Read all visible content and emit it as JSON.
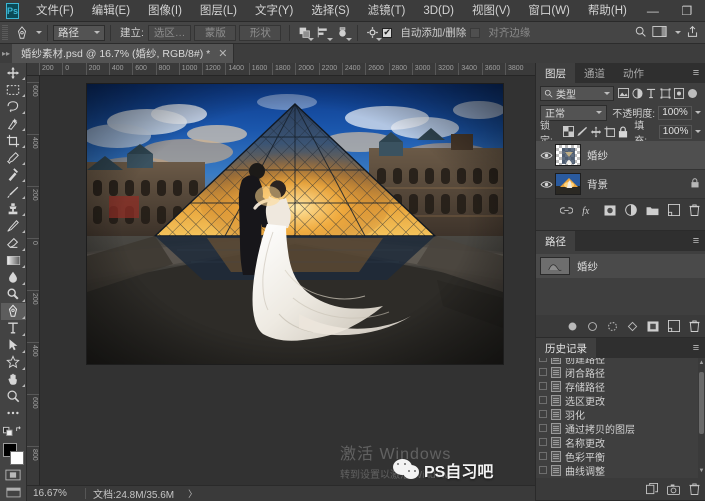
{
  "app": {
    "name": "Adobe Photoshop",
    "logo_text": "Ps",
    "accent": "#3bb6d4"
  },
  "menubar": {
    "items": [
      {
        "label": "文件(F)"
      },
      {
        "label": "编辑(E)"
      },
      {
        "label": "图像(I)"
      },
      {
        "label": "图层(L)"
      },
      {
        "label": "文字(Y)"
      },
      {
        "label": "选择(S)"
      },
      {
        "label": "滤镜(T)"
      },
      {
        "label": "3D(D)"
      },
      {
        "label": "视图(V)"
      },
      {
        "label": "窗口(W)"
      },
      {
        "label": "帮助(H)"
      }
    ],
    "window_controls": [
      {
        "name": "minimize",
        "glyph": "—"
      },
      {
        "name": "maximize",
        "glyph": "❐"
      },
      {
        "name": "close",
        "glyph": "✕"
      }
    ]
  },
  "options_bar": {
    "tool_icon": "pen-tool-icon",
    "mode_select": "路径",
    "make_label": "建立:",
    "buttons": [
      {
        "label": "选区…"
      },
      {
        "label": "蒙版"
      },
      {
        "label": "形状"
      }
    ],
    "icon_buttons": [
      {
        "name": "path-operations-icon"
      },
      {
        "name": "path-alignment-icon"
      },
      {
        "name": "path-arrangement-icon"
      },
      {
        "name": "geometry-options-gear-icon"
      }
    ],
    "auto_add_delete": {
      "label": "自动添加/删除",
      "checked": true
    },
    "align_edges": {
      "label": "对齐边缘",
      "checked": false
    },
    "right_icons": [
      {
        "name": "search-icon"
      },
      {
        "name": "workspace-icon"
      },
      {
        "name": "share-icon"
      }
    ]
  },
  "document_tab": {
    "title": "婚纱素材.psd @ 16.7% (婚纱, RGB/8#) *",
    "close_glyph": "✕"
  },
  "toolbar": {
    "tools": [
      {
        "name": "move-tool",
        "icon": "move-icon",
        "active": false
      },
      {
        "name": "marquee-tool",
        "icon": "rect-marquee-icon",
        "active": false
      },
      {
        "name": "lasso-tool",
        "icon": "lasso-icon",
        "active": false
      },
      {
        "name": "quick-selection-tool",
        "icon": "quick-select-icon",
        "active": false
      },
      {
        "name": "crop-tool",
        "icon": "crop-icon",
        "active": false
      },
      {
        "name": "eyedropper-tool",
        "icon": "eyedropper-icon",
        "active": false
      },
      {
        "name": "healing-brush-tool",
        "icon": "healing-brush-icon",
        "active": false
      },
      {
        "name": "brush-tool",
        "icon": "brush-icon",
        "active": false
      },
      {
        "name": "clone-stamp-tool",
        "icon": "clone-stamp-icon",
        "active": false
      },
      {
        "name": "history-brush-tool",
        "icon": "history-brush-icon",
        "active": false
      },
      {
        "name": "eraser-tool",
        "icon": "eraser-icon",
        "active": false
      },
      {
        "name": "gradient-tool",
        "icon": "gradient-icon",
        "active": false
      },
      {
        "name": "blur-tool",
        "icon": "blur-drop-icon",
        "active": false
      },
      {
        "name": "dodge-tool",
        "icon": "dodge-icon",
        "active": false
      },
      {
        "name": "pen-tool",
        "icon": "pen-icon",
        "active": true
      },
      {
        "name": "type-tool",
        "icon": "type-t-icon",
        "active": false
      },
      {
        "name": "path-selection-tool",
        "icon": "path-arrow-icon",
        "active": false
      },
      {
        "name": "shape-tool",
        "icon": "custom-shape-icon",
        "active": false
      },
      {
        "name": "hand-tool",
        "icon": "hand-icon",
        "active": false
      },
      {
        "name": "zoom-tool",
        "icon": "magnifier-icon",
        "active": false
      },
      {
        "name": "edit-toolbar",
        "icon": "ellipsis-icon",
        "active": false
      }
    ],
    "foreground_color": "#000000",
    "background_color": "#ffffff",
    "quick_mask": "quick-mask-icon"
  },
  "ruler": {
    "h_ticks": [
      "200",
      "0",
      "200",
      "400",
      "600",
      "800",
      "1000",
      "1200",
      "1400",
      "1600",
      "1800",
      "2000",
      "2200",
      "2400",
      "2600",
      "2800",
      "3000",
      "3200",
      "3400",
      "3600",
      "3800"
    ],
    "v_ticks": [
      "600",
      "400",
      "200",
      "0",
      "200",
      "400",
      "600",
      "800"
    ]
  },
  "canvas": {
    "image_alt": "wedding-couple-at-louvre-pyramid-sunset"
  },
  "statusbar": {
    "zoom": "16.67%",
    "doc_size": "文档:24.8M/35.6M",
    "arrow": "〉"
  },
  "layers_panel": {
    "tabs": [
      {
        "label": "图层",
        "active": true
      },
      {
        "label": "通道",
        "active": false
      },
      {
        "label": "动作",
        "active": false
      }
    ],
    "menu_glyph": "≡",
    "filter": {
      "label": "类型",
      "icon": "search-icon"
    },
    "filter_icons": [
      "pixel-layer-filter-icon",
      "adjustment-layer-filter-icon",
      "type-layer-filter-icon",
      "shape-layer-filter-icon",
      "smart-object-filter-icon"
    ],
    "blend_mode": "正常",
    "opacity_label": "不透明度:",
    "opacity_value": "100%",
    "lock_label": "锁定:",
    "lock_icons": [
      "lock-transparency-icon",
      "lock-image-icon",
      "lock-position-icon",
      "lock-artboard-icon",
      "lock-all-icon"
    ],
    "fill_label": "填充:",
    "fill_value": "100%",
    "layers": [
      {
        "name": "婚纱",
        "visible": true,
        "selected": true,
        "locked": false,
        "thumb": "checker"
      },
      {
        "name": "背景",
        "visible": true,
        "selected": false,
        "locked": true,
        "thumb": "photo"
      }
    ],
    "footer_icons": [
      "link-layers-icon",
      "layer-style-fx-icon",
      "add-layer-mask-icon",
      "new-adjustment-layer-icon",
      "new-group-icon",
      "new-layer-icon",
      "delete-layer-icon"
    ]
  },
  "paths_panel": {
    "tabs": [
      {
        "label": "路径",
        "active": true
      }
    ],
    "menu_glyph": "≡",
    "paths": [
      {
        "name": "婚纱",
        "selected": true
      }
    ],
    "footer_icons": [
      "fill-path-icon",
      "stroke-path-icon",
      "load-selection-icon",
      "make-work-path-icon",
      "add-mask-icon",
      "new-path-icon",
      "delete-path-icon"
    ]
  },
  "history_panel": {
    "tabs": [
      {
        "label": "历史记录",
        "active": true
      }
    ],
    "menu_glyph": "≡",
    "items": [
      {
        "label": "创建路径"
      },
      {
        "label": "闭合路径"
      },
      {
        "label": "存储路径"
      },
      {
        "label": "选区更改"
      },
      {
        "label": "羽化"
      },
      {
        "label": "通过拷贝的图层"
      },
      {
        "label": "名称更改"
      },
      {
        "label": "色彩平衡"
      },
      {
        "label": "曲线调整"
      }
    ],
    "footer_icons": [
      "new-document-from-state-icon",
      "new-snapshot-icon",
      "delete-state-icon"
    ]
  },
  "watermarks": {
    "windows_activate_line1": "激活 Windows",
    "windows_activate_line2": "转到设置以激活 Windows",
    "channel_name": "PS自习吧",
    "channel_icon": "wechat-icon"
  }
}
